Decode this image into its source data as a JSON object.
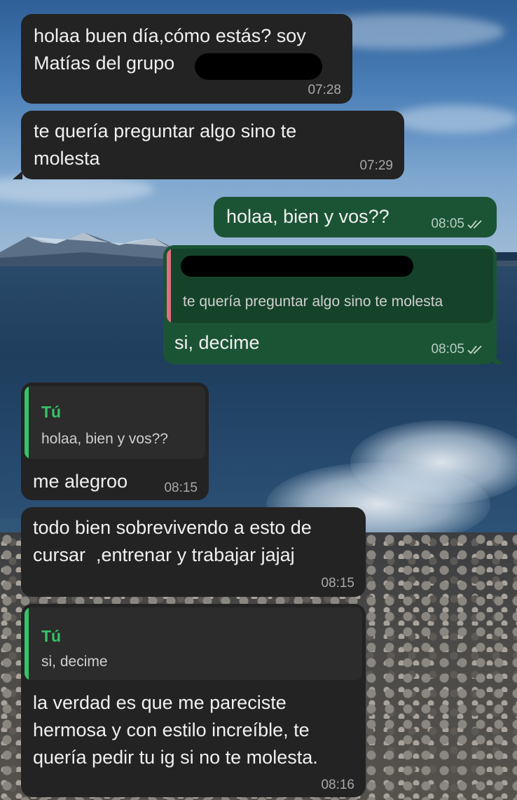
{
  "messages": [
    {
      "id": "m1",
      "text_line1": "holaa buen día,cómo estás? soy",
      "text_line2": "Matías del grupo",
      "time": "07:28"
    },
    {
      "id": "m2",
      "text_line1": "te quería preguntar algo sino te",
      "text_line2": "molesta",
      "time": "07:29"
    },
    {
      "id": "m3",
      "text": "holaa, bien y vos??",
      "time": "08:05"
    },
    {
      "id": "m4",
      "quote_text": "te quería preguntar algo sino te molesta",
      "text": "si, decime",
      "time": "08:05"
    },
    {
      "id": "m5",
      "quote_author": "Tú",
      "quote_text": "holaa, bien y vos??",
      "text": "me alegroo",
      "time": "08:15"
    },
    {
      "id": "m6",
      "text_line1": "todo bien sobrevivendo a esto de",
      "text_line2": "cursar  ,entrenar y trabajar jajaj",
      "time": "08:15"
    },
    {
      "id": "m7",
      "quote_author": "Tú",
      "quote_text": "si, decime",
      "text_line1": "la verdad es que me pareciste",
      "text_line2": "hermosa y con estilo increíble, te",
      "text_line3": "quería pedir tu ig si no te molesta.",
      "time": "08:16"
    }
  ],
  "colors": {
    "incoming_bubble": "#232323",
    "outgoing_bubble": "#1b5434",
    "quote_bar_self": "#35c46a",
    "quote_bar_other": "#e07080"
  },
  "icons": {
    "read_receipt": "double-check-icon"
  }
}
